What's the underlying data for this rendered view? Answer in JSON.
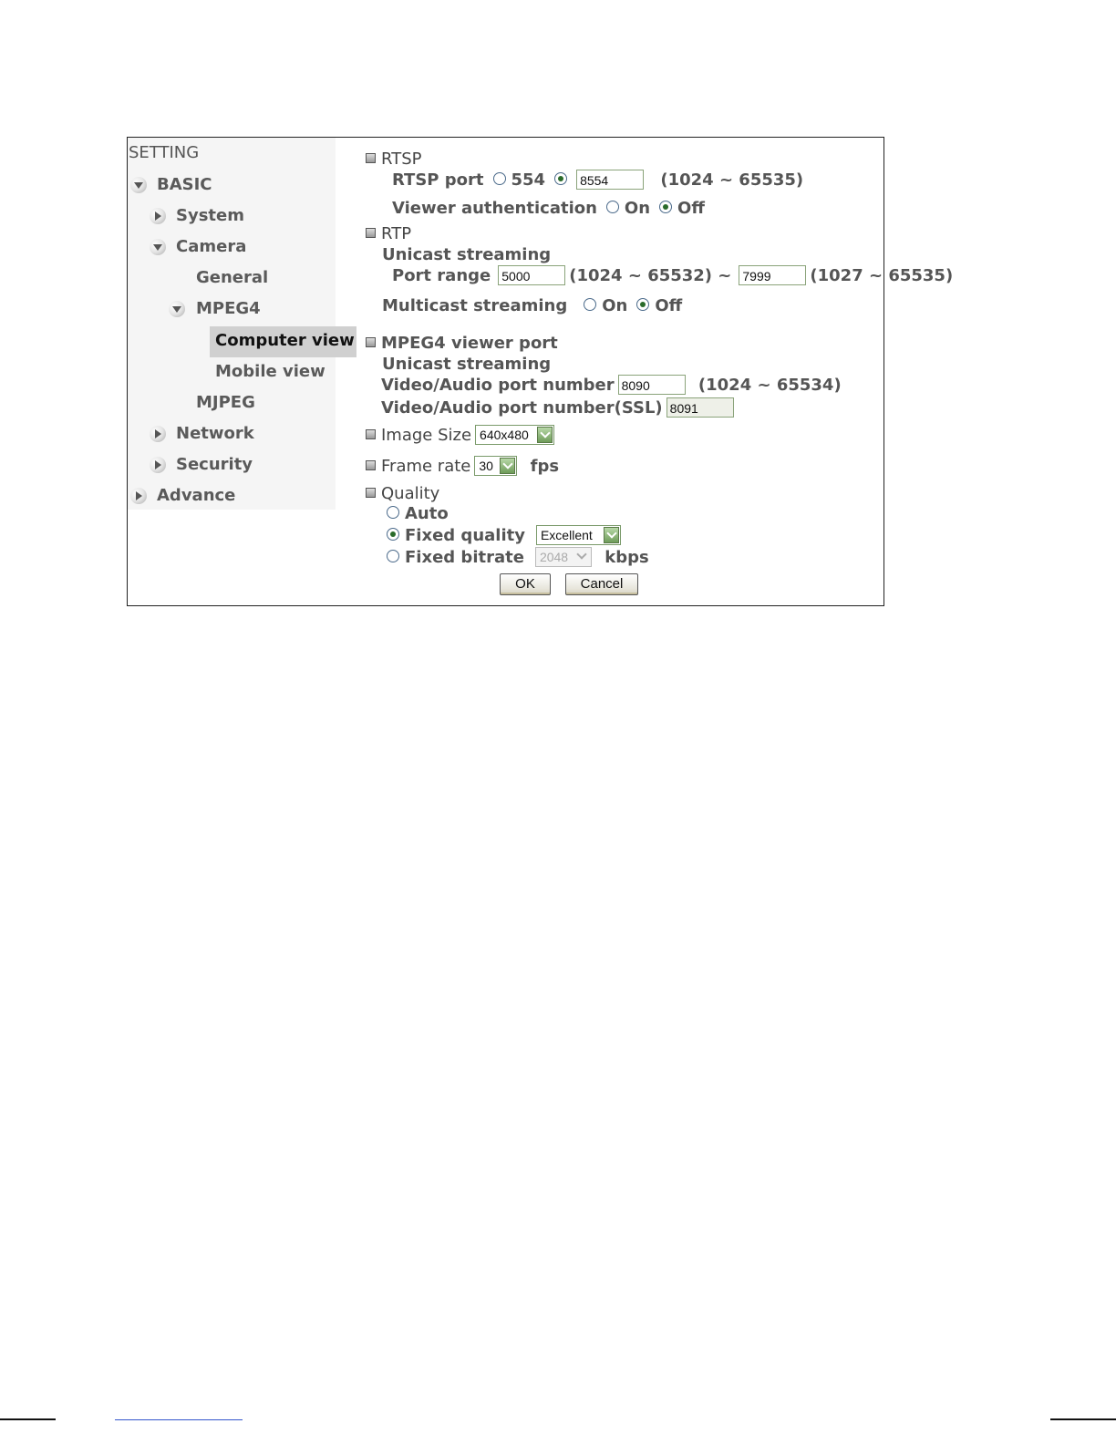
{
  "sidebar": {
    "title": "SETTING",
    "items": [
      {
        "label": "BASIC",
        "arrow": "down"
      },
      {
        "label": "System",
        "arrow": "right"
      },
      {
        "label": "Camera",
        "arrow": "down"
      },
      {
        "label": "General",
        "arrow": "none"
      },
      {
        "label": "MPEG4",
        "arrow": "down"
      },
      {
        "label": "Computer view",
        "arrow": "none",
        "active": true
      },
      {
        "label": "Mobile view",
        "arrow": "none"
      },
      {
        "label": "MJPEG",
        "arrow": "none"
      },
      {
        "label": "Network",
        "arrow": "right"
      },
      {
        "label": "Security",
        "arrow": "right"
      },
      {
        "label": "Advance",
        "arrow": "right"
      }
    ]
  },
  "rtsp": {
    "title": "RTSP",
    "port_label": "RTSP port",
    "port_default": "554",
    "port_value": "8554",
    "port_range": "(1024 ~ 65535)",
    "auth_label": "Viewer authentication",
    "on": "On",
    "off": "Off"
  },
  "rtp": {
    "title": "RTP",
    "unicast_label": "Unicast streaming",
    "port_range_label": "Port range",
    "port_start": "5000",
    "start_range": "(1024 ~ 65532) ~",
    "port_end": "7999",
    "end_range": "(1027 ~ 65535)",
    "multicast_label": "Multicast streaming",
    "on": "On",
    "off": "Off"
  },
  "viewer_port": {
    "title": "MPEG4 viewer port",
    "unicast_label": "Unicast streaming",
    "va_label": "Video/Audio port number",
    "va_value": "8090",
    "va_range": "(1024 ~ 65534)",
    "ssl_label": "Video/Audio port number(SSL)",
    "ssl_value": "8091"
  },
  "image_size": {
    "title": "Image Size",
    "value": "640x480"
  },
  "frame_rate": {
    "title": "Frame rate",
    "value": "30",
    "unit": "fps"
  },
  "quality": {
    "title": "Quality",
    "auto_label": "Auto",
    "fixed_quality_label": "Fixed quality",
    "fixed_quality_value": "Excellent",
    "fixed_bitrate_label": "Fixed bitrate",
    "fixed_bitrate_value": "2048",
    "bitrate_unit": "kbps"
  },
  "buttons": {
    "ok": "OK",
    "cancel": "Cancel"
  },
  "colors": {
    "sidebar_bg": "#f5f5f5",
    "active_item_bg": "#d0d0d0",
    "dropdown_green": "#6f9c5a",
    "radio_dot": "#2a6b2a"
  }
}
